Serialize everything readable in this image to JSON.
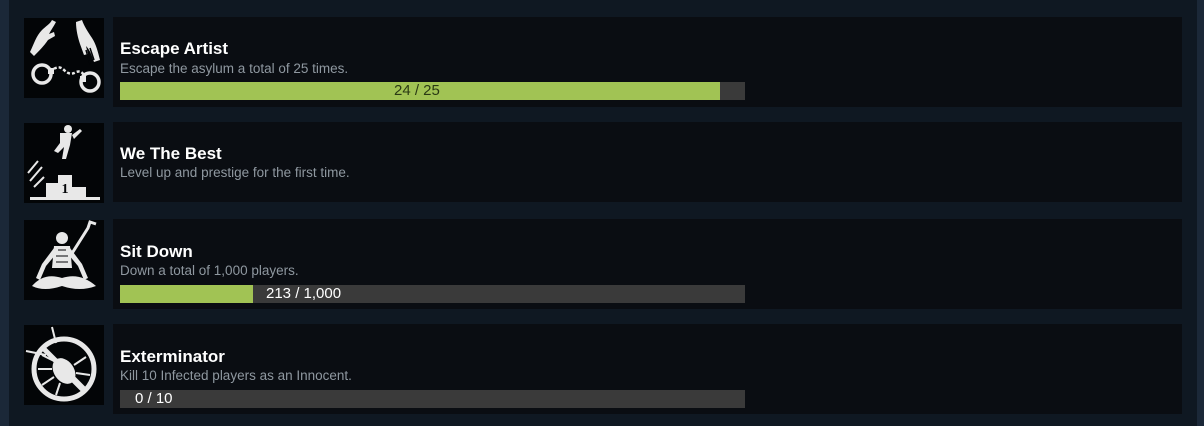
{
  "achievements": [
    {
      "icon": "handcuffs-hands-icon",
      "title": "Escape Artist",
      "description": "Escape the asylum a total of 25 times.",
      "progress": {
        "current": 24,
        "total": 25,
        "fraction": 0.96,
        "label": "24 / 25"
      }
    },
    {
      "icon": "podium-jump-icon",
      "title": "We The Best",
      "description": "Level up and prestige for the first time.",
      "podium_digit": "1"
    },
    {
      "icon": "meditating-figure-icon",
      "title": "Sit Down",
      "description": "Down a total of 1,000 players.",
      "progress": {
        "current": 213,
        "total": 1000,
        "fraction": 0.213,
        "label": "213 / 1,000"
      }
    },
    {
      "icon": "crossed-bug-icon",
      "title": "Exterminator",
      "description": "Kill 10 Infected players as an Innocent.",
      "progress": {
        "current": 0,
        "total": 10,
        "fraction": 0.0,
        "label": "0 / 10"
      }
    }
  ],
  "colors": {
    "background": "#1b2838",
    "panel": "#0f1822",
    "card": "#0a0d12",
    "progress_fill": "#a1c354",
    "progress_track": "#3a3a3a",
    "title_text": "#ffffff",
    "description_text": "#8f98a0"
  }
}
